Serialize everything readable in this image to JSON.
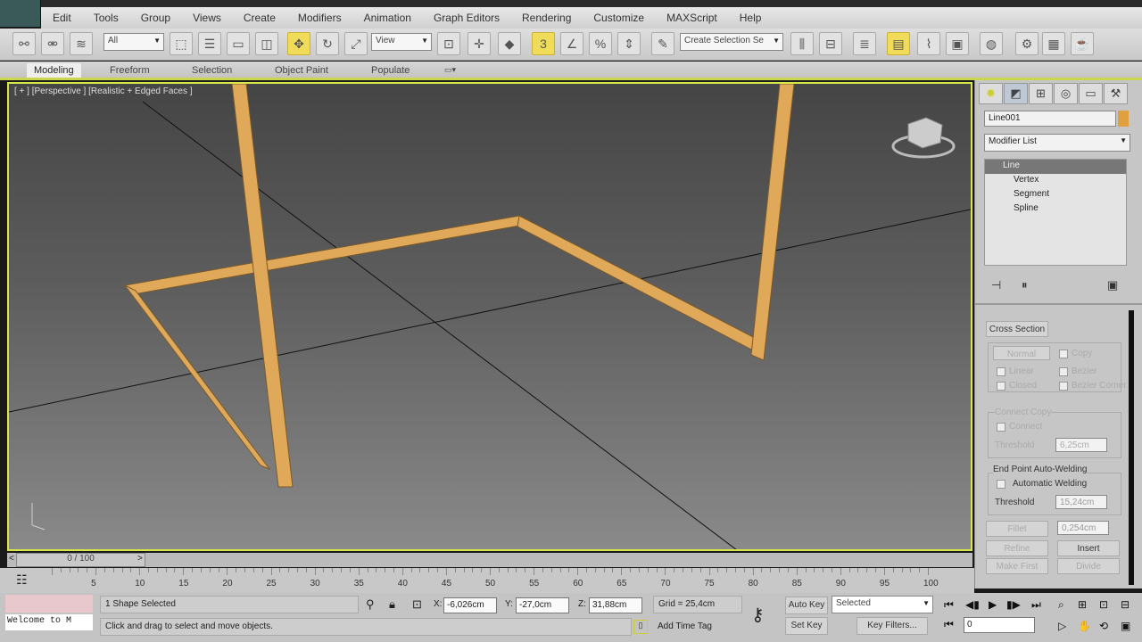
{
  "menus": [
    "Edit",
    "Tools",
    "Group",
    "Views",
    "Create",
    "Modifiers",
    "Animation",
    "Graph Editors",
    "Rendering",
    "Customize",
    "MAXScript",
    "Help"
  ],
  "toolbar": {
    "selection_filter": "All",
    "ref_coord": "View",
    "named_selection": "Create Selection Se",
    "snap_label": "3"
  },
  "ribbon": {
    "tabs": [
      "Modeling",
      "Freeform",
      "Selection",
      "Object Paint",
      "Populate"
    ]
  },
  "viewport": {
    "label": "[ + ] [Perspective ] [Realistic + Edged Faces ]",
    "accent": "#d8e84a",
    "beam_color": "#e0a95a"
  },
  "command_panel": {
    "object_name": "Line001",
    "object_color": "#e0a040",
    "modifier_list": "Modifier List",
    "stack": [
      "Line",
      "Vertex",
      "Segment",
      "Spline"
    ],
    "cross_section": "Cross Section",
    "normal": "Normal",
    "copy": "Copy",
    "linear": "Linear",
    "bezier": "Bezier",
    "closed": "Closed",
    "bezier_corner": "Bezier Corner",
    "connect_copy": "Connect Copy",
    "connect": "Connect",
    "threshold_dis": "Threshold",
    "threshold_dis_val": "6,25cm",
    "end_point_group": "End Point Auto-Welding",
    "auto_weld": "Automatic Welding",
    "threshold": "Threshold",
    "threshold_val": "15,24cm",
    "fillet": "Fillet",
    "fillet_val": "0,254cm",
    "refine": "Refine",
    "insert": "Insert",
    "make_first": "Make First",
    "divide": "Divide"
  },
  "timeline": {
    "position": "0 / 100",
    "ticks": [
      "5",
      "10",
      "15",
      "20",
      "25",
      "30",
      "35",
      "40",
      "45",
      "50",
      "55",
      "60",
      "65",
      "70",
      "75",
      "80",
      "85",
      "90",
      "95",
      "100"
    ],
    "prev": "<",
    "next": ">"
  },
  "status": {
    "maxscript": "Welcome to M",
    "selection": "1 Shape Selected",
    "prompt": "Click and drag to select and move objects.",
    "x_label": "X:",
    "x": "-6,026cm",
    "y_label": "Y:",
    "y": "-27,0cm",
    "z_label": "Z:",
    "z": "31,88cm",
    "grid": "Grid = 25,4cm",
    "add_time_tag": "Add Time Tag",
    "auto_key": "Auto Key",
    "set_key": "Set Key",
    "key_mode": "Selected",
    "key_filters": "Key Filters...",
    "frame": "0"
  }
}
